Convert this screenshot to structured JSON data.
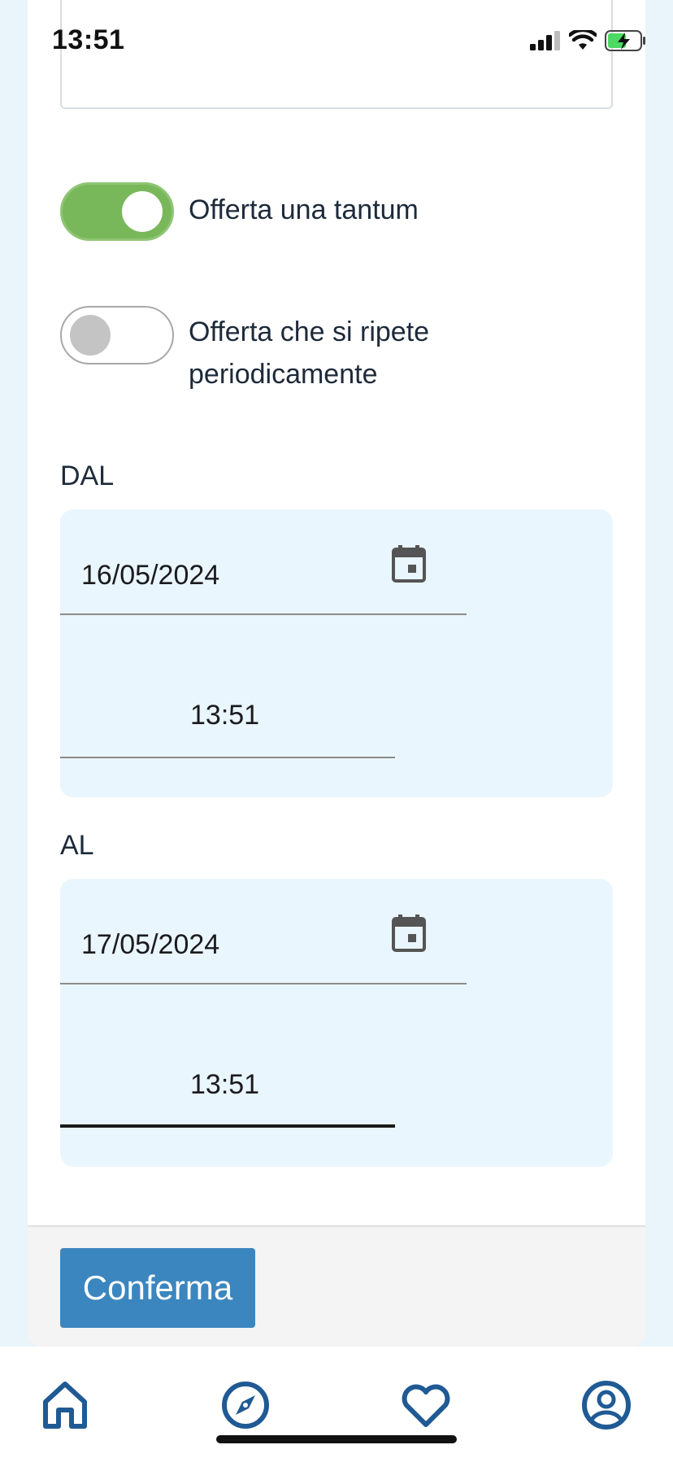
{
  "status_bar": {
    "time": "13:51"
  },
  "toggles": [
    {
      "label": "Offerta una tantum",
      "on": true
    },
    {
      "label": "Offerta che si ripete periodicamente",
      "on": false
    }
  ],
  "from": {
    "label": "DAL",
    "date": "16/05/2024",
    "time": "13:51"
  },
  "to": {
    "label": "AL",
    "date": "17/05/2024",
    "time": "13:51"
  },
  "footer": {
    "confirm_label": "Conferma"
  },
  "tabs": [
    "home-icon",
    "compass-icon",
    "heart-icon",
    "profile-icon"
  ],
  "colors": {
    "accent": "#3b86bf",
    "toggle_on": "#79b85a",
    "tab_icon": "#1f5a94",
    "panel_bg": "#eaf6fd"
  }
}
